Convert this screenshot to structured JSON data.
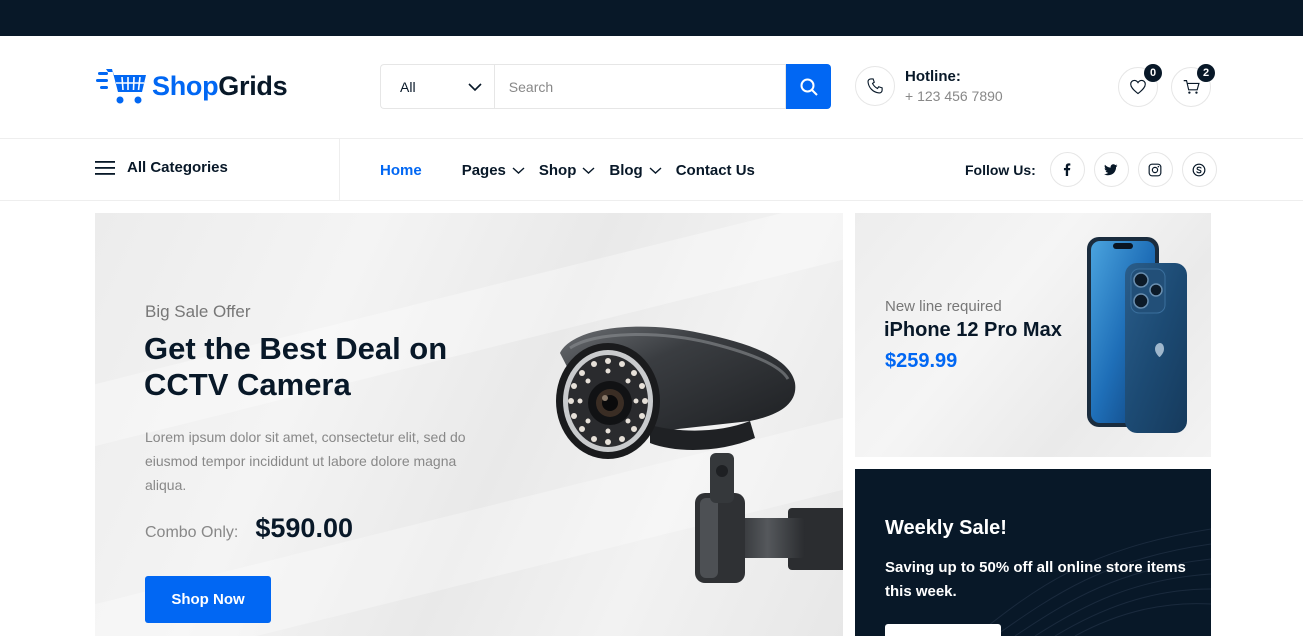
{
  "brand": {
    "name_part1": "Shop",
    "name_part2": "Grids"
  },
  "search": {
    "category_selected": "All",
    "placeholder": "Search"
  },
  "hotline": {
    "label": "Hotline:",
    "number": "+ 123 456 7890"
  },
  "wishlist": {
    "count": "0"
  },
  "cart": {
    "count": "2"
  },
  "nav": {
    "all_categories": "All Categories",
    "items": [
      {
        "label": "Home"
      },
      {
        "label": "Pages"
      },
      {
        "label": "Shop"
      },
      {
        "label": "Blog"
      },
      {
        "label": "Contact Us"
      }
    ],
    "follow_label": "Follow Us:"
  },
  "hero": {
    "subtitle": "Big Sale Offer",
    "title": "Get the Best Deal on CCTV Camera",
    "description": "Lorem ipsum dolor sit amet, consectetur elit, sed do eiusmod tempor incididunt ut labore dolore magna aliqua.",
    "price_label": "Combo Only:",
    "price": "$590.00",
    "button": "Shop Now"
  },
  "promo_top": {
    "subtitle": "New line required",
    "title": "iPhone 12 Pro Max",
    "price": "$259.99"
  },
  "promo_bottom": {
    "title": "Weekly Sale!",
    "description": "Saving up to 50% off all online store items this week."
  },
  "colors": {
    "accent": "#0167f3",
    "dark": "#081828"
  },
  "icons": [
    "cart-logo-icon",
    "chevron-down-icon",
    "search-icon",
    "phone-icon",
    "heart-icon",
    "cart-icon",
    "menu-icon",
    "facebook-icon",
    "twitter-icon",
    "instagram-icon",
    "skype-icon"
  ]
}
